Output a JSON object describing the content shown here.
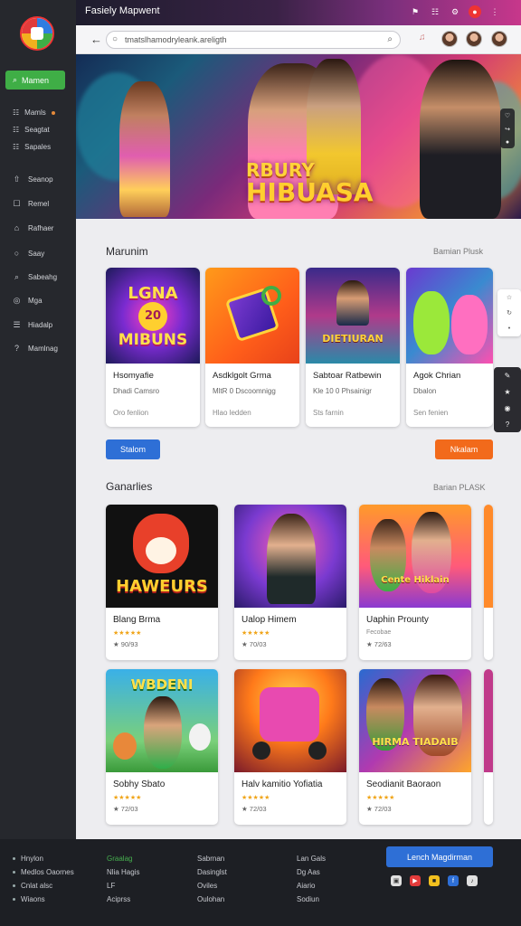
{
  "window": {
    "title": "Fasiely Mapwent"
  },
  "colors": {
    "accent_green": "#3fae46",
    "accent_blue": "#2e6fd6",
    "accent_orange": "#f26a1b",
    "sidebar_bg": "#26282d"
  },
  "address": {
    "url": "tmatslhamodryleank.areligth"
  },
  "sidebar": {
    "main_button": "Mamen",
    "mini_items": [
      {
        "label": "Mamls"
      },
      {
        "label": "Seagtat"
      },
      {
        "label": "Sapales"
      }
    ],
    "items": [
      {
        "label": "Seanop",
        "icon": "upload-icon"
      },
      {
        "label": "Remel",
        "icon": "document-icon"
      },
      {
        "label": "Rafhaer",
        "icon": "home-icon"
      },
      {
        "label": "Saay",
        "icon": "chat-icon"
      },
      {
        "label": "Sabeahg",
        "icon": "search-icon"
      },
      {
        "label": "Mga",
        "icon": "compass-icon"
      },
      {
        "label": "Hiadalp",
        "icon": "list-icon"
      },
      {
        "label": "Mamlnag",
        "icon": "help-icon"
      }
    ]
  },
  "hero": {
    "title_line1": "RBURY",
    "title_line2": "HIBUASA"
  },
  "section1": {
    "title": "Marunim",
    "link": "Bamian Plusk",
    "cards": [
      {
        "art_text_top": "LGNA",
        "art_badge": "20",
        "art_text_bottom": "MIBUNS",
        "title": "Hsomyafie",
        "subtitle": "Dhadi Camsro",
        "meta": "Oro fenlion"
      },
      {
        "art_text_top": "",
        "art_badge": "",
        "art_text_bottom": "",
        "title": "Asdklgolt Grma",
        "subtitle": "MltR 0 Dscoomnigg",
        "meta": "Hlao ledden"
      },
      {
        "art_text_top": "",
        "art_badge": "",
        "art_text_bottom": "DIETIURAN",
        "title": "Sabtoar Ratbewin",
        "subtitle": "Kle 10 0 Phsainigr",
        "meta": "Sts farnin"
      },
      {
        "art_text_top": "",
        "art_badge": "",
        "art_text_bottom": "",
        "title": "Agok Chrian",
        "subtitle": "Dbalon",
        "meta": "Sen fenien"
      }
    ],
    "btn_left": "Stalom",
    "btn_right": "Nkalam"
  },
  "section2": {
    "title": "Ganarlies",
    "link": "Barian PLASK",
    "cards": [
      {
        "art_text": "HAWEURS",
        "title": "Blang Brma",
        "rating": "★★★★★",
        "meta": "★ 90/93"
      },
      {
        "art_text": "",
        "title": "Ualop Himem",
        "rating": "★★★★★",
        "meta": "★ 70/03"
      },
      {
        "art_text": "Cente Hiklain",
        "title": "Uaphin Prounty",
        "rating": "Fecobae",
        "meta": "★ 72/63"
      },
      {
        "art_text": "WBDENI",
        "title": "Sobhy Sbato",
        "rating": "★★★★★",
        "meta": "★ 72/03"
      },
      {
        "art_text": "",
        "title": "Halv kamitio Yofiatia",
        "rating": "★★★★★",
        "meta": "★ 72/03"
      },
      {
        "art_text": "HIRMA TIADAIB",
        "title": "Seodianit Baoraon",
        "rating": "★★★★★",
        "meta": "★ 72/03"
      }
    ]
  },
  "footer": {
    "col1": [
      "Hnylon",
      "Medlos Oaornes",
      "Cnlat alsc",
      "Wiaons"
    ],
    "col2": [
      "Graalag",
      "Nlia Hagis",
      "LF",
      "Aciprss"
    ],
    "col3": [
      "Sabrnan",
      "Dasinglst",
      "Oviles",
      "Oulohan"
    ],
    "col4": [
      "Lan Gals",
      "Dg Aas",
      "Aiario",
      "Sodiun"
    ],
    "button": "Lench Magdirman"
  }
}
